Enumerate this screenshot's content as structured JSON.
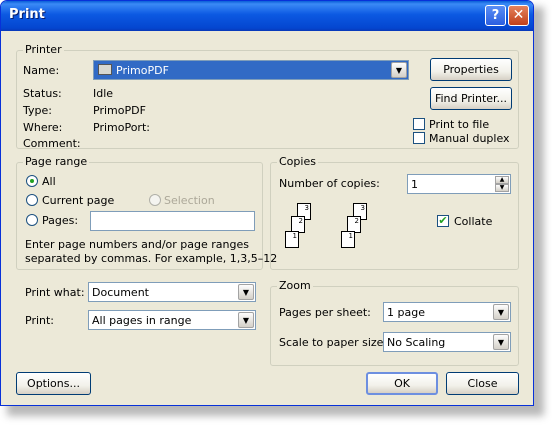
{
  "window": {
    "title": "Print"
  },
  "printer": {
    "legend": "Printer",
    "name_label": "Name:",
    "name_value": "PrimoPDF",
    "status_label": "Status:",
    "status_value": "Idle",
    "type_label": "Type:",
    "type_value": "PrimoPDF",
    "where_label": "Where:",
    "where_value": "PrimoPort:",
    "comment_label": "Comment:",
    "properties_button": "Properties",
    "find_printer_button": "Find Printer...",
    "print_to_file_label": "Print to file",
    "manual_duplex_label": "Manual duplex",
    "print_to_file_checked": false,
    "manual_duplex_checked": false
  },
  "page_range": {
    "legend": "Page range",
    "all_label": "All",
    "current_page_label": "Current page",
    "selection_label": "Selection",
    "pages_label": "Pages:",
    "pages_value": "",
    "selected": "All",
    "help_line1": "Enter page numbers and/or page ranges",
    "help_line2": "separated by commas.  For example, 1,3,5–12"
  },
  "copies": {
    "legend": "Copies",
    "number_label": "Number of copies:",
    "number_value": "1",
    "collate_label": "Collate",
    "collate_checked": true,
    "page_numbers": [
      "3",
      "2",
      "1",
      "3",
      "2",
      "1"
    ]
  },
  "print_what": {
    "label": "Print what:",
    "value": "Document"
  },
  "print": {
    "label": "Print:",
    "value": "All pages in range"
  },
  "zoom": {
    "legend": "Zoom",
    "pages_per_sheet_label": "Pages per sheet:",
    "pages_per_sheet_value": "1 page",
    "scale_label": "Scale to paper size:",
    "scale_value": "No Scaling"
  },
  "buttons": {
    "options": "Options...",
    "ok": "OK",
    "close": "Close"
  },
  "icons": {
    "help": "?",
    "close": "✕",
    "dropdown": "▼",
    "check": "✔"
  }
}
